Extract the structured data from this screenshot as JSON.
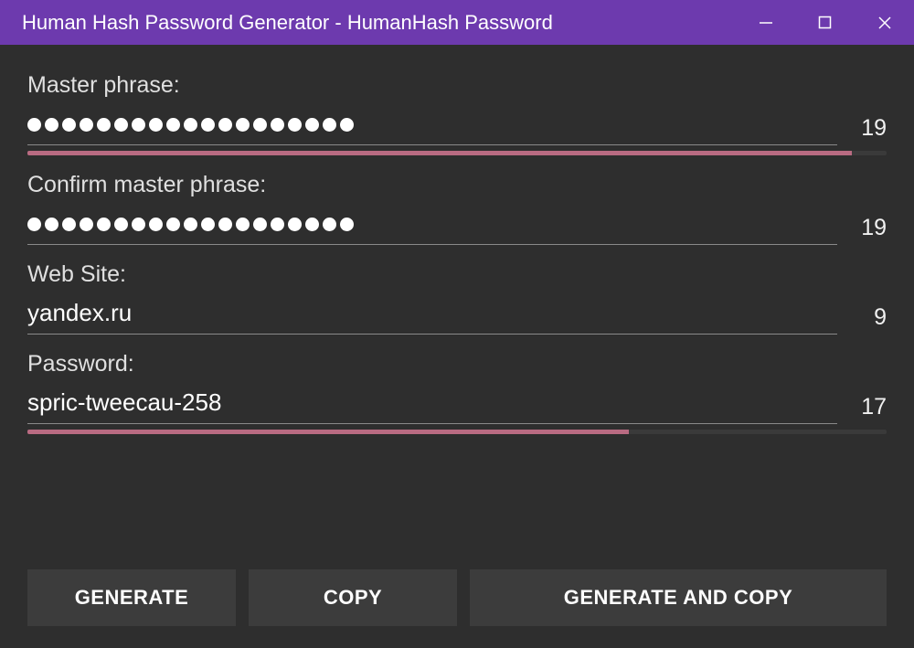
{
  "titlebar": {
    "title": "Human Hash Password Generator - HumanHash Password"
  },
  "fields": {
    "master": {
      "label": "Master phrase:",
      "dot_count": 19,
      "count": "19",
      "strength_pct": 96
    },
    "confirm": {
      "label": "Confirm master phrase:",
      "dot_count": 19,
      "count": "19"
    },
    "website": {
      "label": "Web Site:",
      "value": "yandex.ru",
      "count": "9"
    },
    "password": {
      "label": "Password:",
      "value": "spric-tweecau-258",
      "count": "17",
      "strength_pct": 70
    }
  },
  "buttons": {
    "generate": "GENERATE",
    "copy": "COPY",
    "generate_copy": "GENERATE AND COPY"
  },
  "colors": {
    "accent": "#6d3aae",
    "strength": "#b96b82",
    "panel": "#2e2e2e",
    "button": "#3c3c3c"
  }
}
